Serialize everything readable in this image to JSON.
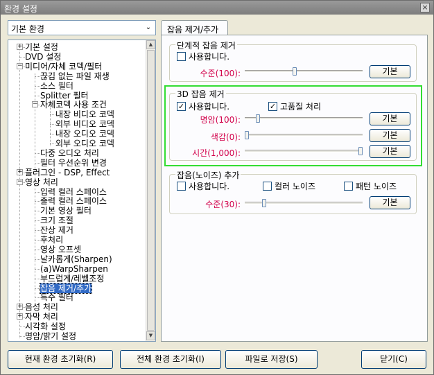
{
  "window": {
    "title": "환경 설정",
    "close": "×"
  },
  "category_select": {
    "value": "기본 환경",
    "arrow": "⌄"
  },
  "tree": [
    {
      "label": "기본 설정",
      "level": 0,
      "expander": "+"
    },
    {
      "label": "DVD 설정",
      "level": 0
    },
    {
      "label": "미디어/자체 코덱/필터",
      "level": 0,
      "expander": "−"
    },
    {
      "label": "끊김 없는 파일 재생",
      "level": 1
    },
    {
      "label": "소스 필터",
      "level": 1
    },
    {
      "label": "Splitter 필터",
      "level": 1
    },
    {
      "label": "자체코덱 사용 조건",
      "level": 1,
      "expander": "−"
    },
    {
      "label": "내장 비디오 코덱",
      "level": 2
    },
    {
      "label": "외부 비디오 코덱",
      "level": 2
    },
    {
      "label": "내장 오디오 코덱",
      "level": 2
    },
    {
      "label": "외부 오디오 코덱",
      "level": 2
    },
    {
      "label": "다중 오디오 처리",
      "level": 1
    },
    {
      "label": "필터 우선순위 변경",
      "level": 1
    },
    {
      "label": "플러그인 - DSP, Effect",
      "level": 0,
      "expander": "+"
    },
    {
      "label": "영상 처리",
      "level": 0,
      "expander": "−"
    },
    {
      "label": "입력 컬러 스페이스",
      "level": 1
    },
    {
      "label": "출력 컬러 스페이스",
      "level": 1
    },
    {
      "label": "기본 영상 필터",
      "level": 1
    },
    {
      "label": "크기 조절",
      "level": 1
    },
    {
      "label": "잔상 제거",
      "level": 1
    },
    {
      "label": "후처리",
      "level": 1
    },
    {
      "label": "영상 오프셋",
      "level": 1
    },
    {
      "label": "날카롭게(Sharpen)",
      "level": 1
    },
    {
      "label": "(a)WarpSharpen",
      "level": 1
    },
    {
      "label": "부드럽게/레벨조정",
      "level": 1
    },
    {
      "label": "잡음 제거/추가",
      "level": 1,
      "selected": true
    },
    {
      "label": "특수 필터",
      "level": 1
    },
    {
      "label": "음성 처리",
      "level": 0,
      "expander": "+"
    },
    {
      "label": "자막 처리",
      "level": 0,
      "expander": "+"
    },
    {
      "label": "시각화 설정",
      "level": 0
    },
    {
      "label": "명암/밝기 설정",
      "level": 0
    }
  ],
  "scrollbar": {
    "up": "▲",
    "down": "▼"
  },
  "tab": {
    "label": "잡음 제거/추가"
  },
  "step_group": {
    "title": "단계적 잡음 제거",
    "enable": {
      "label": "사용합니다.",
      "checked": false
    },
    "level": {
      "label": "수준(100):",
      "value": 100,
      "fraction": 0.42
    },
    "default_button": "기본"
  },
  "three_d_group": {
    "title": "3D 잡음 제거",
    "enable": {
      "label": "사용합니다.",
      "checked": true
    },
    "high_quality": {
      "label": "고품질 처리",
      "checked": true
    },
    "rows": [
      {
        "label": "명암(100):",
        "value": 100,
        "fraction": 0.1,
        "button": "기본"
      },
      {
        "label": "색감(0):",
        "value": 0,
        "fraction": 0.0,
        "button": "기본"
      },
      {
        "label": "시간(1,000):",
        "value": 1000,
        "fraction": 1.0,
        "button": "기본"
      }
    ]
  },
  "add_group": {
    "title": "잡음(노이즈) 추가",
    "enable": {
      "label": "사용합니다.",
      "checked": false
    },
    "color_noise": {
      "label": "컬러 노이즈",
      "checked": false
    },
    "pattern_noise": {
      "label": "패턴 노이즈",
      "checked": false
    },
    "level": {
      "label": "수준(30):",
      "value": 30,
      "fraction": 0.15
    },
    "default_button": "기본"
  },
  "bottom": {
    "reset_current": "현재 환경 초기화(R)",
    "reset_all": "전체 환경 초기화(I)",
    "save_file": "파일로 저장(S)",
    "close": "닫기(C)"
  },
  "colors": {
    "highlight": "#33dd33",
    "label_red": "#d2004a",
    "selection": "#316ac5"
  }
}
